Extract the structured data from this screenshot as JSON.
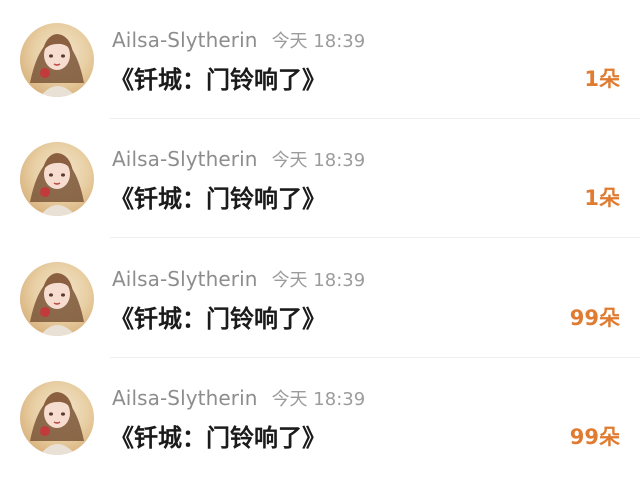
{
  "items": [
    {
      "avatar_icon": "user-avatar-icon",
      "username": "Ailsa-Slytherin",
      "time": "今天 18:39",
      "title": "《钎城：门铃响了》",
      "count": "1朵"
    },
    {
      "avatar_icon": "user-avatar-icon",
      "username": "Ailsa-Slytherin",
      "time": "今天 18:39",
      "title": "《钎城：门铃响了》",
      "count": "1朵"
    },
    {
      "avatar_icon": "user-avatar-icon",
      "username": "Ailsa-Slytherin",
      "time": "今天 18:39",
      "title": "《钎城：门铃响了》",
      "count": "99朵"
    },
    {
      "avatar_icon": "user-avatar-icon",
      "username": "Ailsa-Slytherin",
      "time": "今天 18:39",
      "title": "《钎城：门铃响了》",
      "count": "99朵"
    }
  ],
  "colors": {
    "accent": "#e07c32",
    "username": "#8d8d8d",
    "time": "#9c9c9c",
    "title": "#1b1b1b",
    "divider": "#efefef"
  }
}
